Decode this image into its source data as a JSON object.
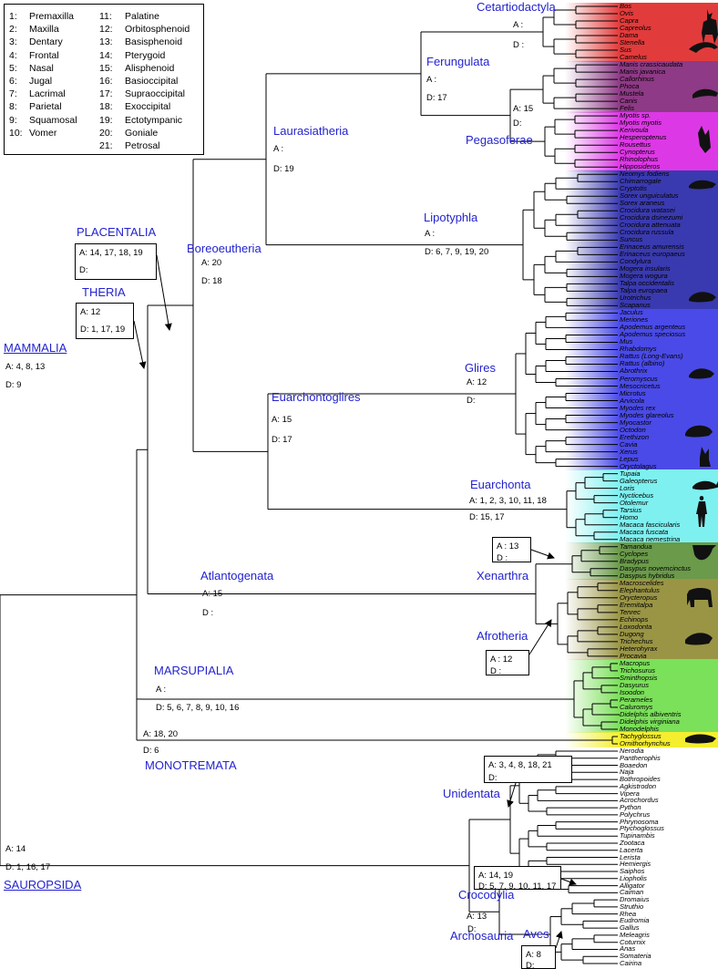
{
  "legend": [
    {
      "n": "1:",
      "name": "Premaxilla"
    },
    {
      "n": "2:",
      "name": "Maxilla"
    },
    {
      "n": "3:",
      "name": "Dentary"
    },
    {
      "n": "4:",
      "name": "Frontal"
    },
    {
      "n": "5:",
      "name": "Nasal"
    },
    {
      "n": "6:",
      "name": "Jugal"
    },
    {
      "n": "7:",
      "name": "Lacrimal"
    },
    {
      "n": "8:",
      "name": "Parietal"
    },
    {
      "n": "9:",
      "name": "Squamosal"
    },
    {
      "n": "10:",
      "name": "Vomer"
    },
    {
      "n": "11:",
      "name": "Palatine"
    },
    {
      "n": "12:",
      "name": "Orbitosphenoid"
    },
    {
      "n": "13:",
      "name": "Basisphenoid"
    },
    {
      "n": "14:",
      "name": "Pterygoid"
    },
    {
      "n": "15:",
      "name": "Alisphenoid"
    },
    {
      "n": "16:",
      "name": "Basioccipital"
    },
    {
      "n": "17:",
      "name": "Supraoccipital"
    },
    {
      "n": "18:",
      "name": "Exoccipital"
    },
    {
      "n": "19:",
      "name": "Ectotympanic"
    },
    {
      "n": "20:",
      "name": "Goniale"
    },
    {
      "n": "21:",
      "name": "Petrosal"
    }
  ],
  "clades": {
    "mammalia": {
      "name": "MAMMALIA",
      "a": "A: 4, 8, 13",
      "d": "D: 9"
    },
    "theria": {
      "name": "THERIA",
      "a": "A: 12",
      "d": "D: 1, 17, 19"
    },
    "placentalia": {
      "name": "PLACENTALIA",
      "a": "A: 14, 17, 18, 19",
      "d": "D:"
    },
    "boreoeutheria": {
      "name": "Boreoeutheria",
      "a": "A: 20",
      "d": "D: 18"
    },
    "laurasiatheria": {
      "name": "Laurasiatheria",
      "a": "A :",
      "d": "D: 19"
    },
    "ferungulata": {
      "name": "Ferungulata",
      "a": "A :",
      "d": "D: 17"
    },
    "cetartiodactyla": {
      "name": "Cetartiodactyla",
      "a": "A :",
      "d": "D :"
    },
    "pegasoferae": {
      "name": "Pegasoferae",
      "a": "A: 15",
      "d": "D:"
    },
    "lipotyphla": {
      "name": "Lipotyphla",
      "a": "A :",
      "d": "D: 6, 7, 9, 19, 20"
    },
    "euarchontoglires": {
      "name": "Euarchontoglires",
      "a": "A: 15",
      "d": "D: 17"
    },
    "glires": {
      "name": "Glires",
      "a": "A: 12",
      "d": "D:"
    },
    "euarchonta": {
      "name": "Euarchonta",
      "a": "A: 1, 2, 3, 10, 11, 18",
      "d": "D: 15, 17"
    },
    "atlantogenata": {
      "name": "Atlantogenata",
      "a": "A: 15",
      "d": "D :"
    },
    "xenarthra": {
      "name": "Xenarthra",
      "a": "A : 13",
      "d": "D :"
    },
    "afrotheria": {
      "name": "Afrotheria",
      "a": "A : 12",
      "d": "D :"
    },
    "marsupialia": {
      "name": "MARSUPIALIA",
      "a": "A :",
      "d": "D: 5, 6, 7, 8, 9, 10, 16"
    },
    "monotremata": {
      "name": "MONOTREMATA",
      "a": "A: 18, 20",
      "d": "D: 6"
    },
    "sauropsida": {
      "name": "SAUROPSIDA",
      "a": "A: 14",
      "d": "D: 1, 16, 17"
    },
    "unidentata": {
      "name": "Unidentata",
      "a": "A: 3, 4, 8, 18, 21",
      "d": "D:"
    },
    "crocodylia": {
      "name": "Crocodylia",
      "a": "A: 14, 19",
      "d": "D: 5, 7, 9, 10, 11, 17"
    },
    "archosauria": {
      "name": "Archosauria",
      "a": "A: 13",
      "d": "D:"
    },
    "aves": {
      "name": "Aves",
      "a": "A: 8",
      "d": "D:"
    }
  },
  "taxa": [
    "Bos",
    "Ovis",
    "Capra",
    "Capreolus",
    "Dama",
    "Stenella",
    "Sus",
    "Camelus",
    "Manis crassicaudata",
    "Manis javanica",
    "Callorhinus",
    "Phoca",
    "Mustela",
    "Canis",
    "Felis",
    "Myotis sp.",
    "Myotis myotis",
    "Kerivoula",
    "Hesperoptenus",
    "Rousettus",
    "Cynopterus",
    "Rhinolophus",
    "Hipposideros",
    "Neomys fodiens",
    "Chimarrogale",
    "Cryptotis",
    "Sorex unguiculatus",
    "Sorex araneus",
    "Crocidura watasei",
    "Crocidura dsinezumi",
    "Crocidura attenuata",
    "Crocidura russula",
    "Suncus",
    "Erinaceus amurensis",
    "Erinaceus europaeus",
    "Condylura",
    "Mogera insularis",
    "Mogera wogura",
    "Talpa occidentalis",
    "Talpa europaea",
    "Urotrichus",
    "Scapanus",
    "Jaculus",
    "Meriones",
    "Apodemus argenteus",
    "Apodemus speciosus",
    "Mus",
    "Rhabdomys",
    "Rattus (Long-Evans)",
    "Rattus (albino)",
    "Abrothrix",
    "Peromyscus",
    "Mesocricetus",
    "Microtus",
    "Arvicola",
    "Myodes rex",
    "Myodes glareolus",
    "Myocastor",
    "Octodon",
    "Erethizon",
    "Cavia",
    "Xerus",
    "Lepus",
    "Oryctolagus",
    "Tupaia",
    "Galeopterus",
    "Loris",
    "Nycticebus",
    "Otolemur",
    "Tarsius",
    "Homo",
    "Macaca fascicularis",
    "Macaca fuscata",
    "Macaca nemestrina",
    "Tamandua",
    "Cyclopes",
    "Bradypus",
    "Dasypus novemcinctus",
    "Dasypus hybridus",
    "Macroscelides",
    "Elephantulus",
    "Orycteropus",
    "Eremitalpa",
    "Tenrec",
    "Echinops",
    "Loxodonta",
    "Dugong",
    "Trichechus",
    "Heterohyrax",
    "Procavia",
    "Macropus",
    "Trichosurus",
    "Sminthopsis",
    "Dasyurus",
    "Isoodon",
    "Perameles",
    "Caluromys",
    "Didelphis albiventris",
    "Didelphis virginiana",
    "Monodelphis",
    "Tachyglossus",
    "Ornithorhynchus",
    "Nerodia",
    "Pantherophis",
    "Boaedon",
    "Naja",
    "Bothropoides",
    "Agkistrodon",
    "Vipera",
    "Acrochordus",
    "Python",
    "Polychrus",
    "Phrynosoma",
    "Ptychoglossus",
    "Tupinambis",
    "Zootaca",
    "Lacerta",
    "Lerista",
    "Hemiergis",
    "Saiphos",
    "Liopholis",
    "Alligator",
    "Caiman",
    "Dromaius",
    "Struthio",
    "Rhea",
    "Eudromia",
    "Gallus",
    "Meleagris",
    "Coturnix",
    "Anas",
    "Somateria",
    "Cairina"
  ],
  "colors": {
    "clade_label": "#2323d0",
    "cetartiodactyla": "#e23b3b",
    "carnivora_pholidota": "#8e3a86",
    "chiroptera": "#dd38e6",
    "lipotyphla": "#3a3ab0",
    "glires": "#4a4ae8",
    "euarchonta": "#7ef0f0",
    "xenarthra": "#6a9a4a",
    "afrotheria": "#9a9545",
    "marsupialia": "#7be05a",
    "monotremata": "#f5ee2f"
  },
  "silhouettes": [
    "deer-icon",
    "dolphin-icon",
    "ferret-icon",
    "bat-icon",
    "shrew-icon",
    "mole-icon",
    "rat-icon",
    "hedgehog-icon",
    "rabbit-icon",
    "tree-shrew-icon",
    "human-icon",
    "sloth-icon",
    "elephant-icon",
    "manatee-icon",
    "platypus-icon"
  ]
}
